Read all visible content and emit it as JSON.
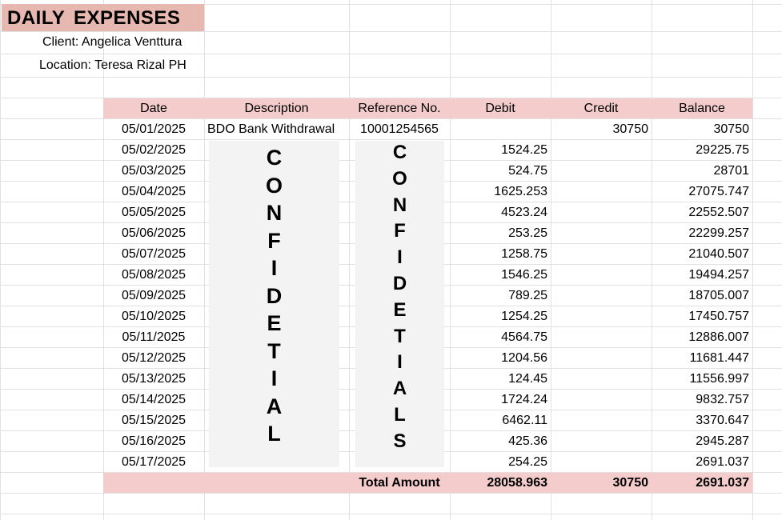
{
  "sheet": {
    "title": "DAILY  EXPENSES",
    "client_label": "Client: Angelica Venttura",
    "location_label": "Location: Teresa Rizal PH"
  },
  "table": {
    "headers": [
      "Date",
      "Description",
      "Reference No.",
      "Debit",
      "Credit",
      "Balance"
    ],
    "rows": [
      {
        "date": "05/01/2025",
        "description": "BDO Bank Withdrawal",
        "reference": "10001254565",
        "debit": "",
        "credit": "30750",
        "balance": "30750"
      },
      {
        "date": "05/02/2025",
        "description": "",
        "reference": "",
        "debit": "1524.25",
        "credit": "",
        "balance": "29225.75"
      },
      {
        "date": "05/03/2025",
        "description": "",
        "reference": "",
        "debit": "524.75",
        "credit": "",
        "balance": "28701"
      },
      {
        "date": "05/04/2025",
        "description": "",
        "reference": "",
        "debit": "1625.253",
        "credit": "",
        "balance": "27075.747"
      },
      {
        "date": "05/05/2025",
        "description": "",
        "reference": "",
        "debit": "4523.24",
        "credit": "",
        "balance": "22552.507"
      },
      {
        "date": "05/06/2025",
        "description": "",
        "reference": "",
        "debit": "253.25",
        "credit": "",
        "balance": "22299.257"
      },
      {
        "date": "05/07/2025",
        "description": "",
        "reference": "",
        "debit": "1258.75",
        "credit": "",
        "balance": "21040.507"
      },
      {
        "date": "05/08/2025",
        "description": "",
        "reference": "",
        "debit": "1546.25",
        "credit": "",
        "balance": "19494.257"
      },
      {
        "date": "05/09/2025",
        "description": "",
        "reference": "",
        "debit": "789.25",
        "credit": "",
        "balance": "18705.007"
      },
      {
        "date": "05/10/2025",
        "description": "",
        "reference": "",
        "debit": "1254.25",
        "credit": "",
        "balance": "17450.757"
      },
      {
        "date": "05/11/2025",
        "description": "",
        "reference": "",
        "debit": "4564.75",
        "credit": "",
        "balance": "12886.007"
      },
      {
        "date": "05/12/2025",
        "description": "",
        "reference": "",
        "debit": "1204.56",
        "credit": "",
        "balance": "11681.447"
      },
      {
        "date": "05/13/2025",
        "description": "",
        "reference": "",
        "debit": "124.45",
        "credit": "",
        "balance": "11556.997"
      },
      {
        "date": "05/14/2025",
        "description": "",
        "reference": "",
        "debit": "1724.24",
        "credit": "",
        "balance": "9832.757"
      },
      {
        "date": "05/15/2025",
        "description": "",
        "reference": "",
        "debit": "6462.11",
        "credit": "",
        "balance": "3370.647"
      },
      {
        "date": "05/16/2025",
        "description": "",
        "reference": "",
        "debit": "425.36",
        "credit": "",
        "balance": "2945.287"
      },
      {
        "date": "05/17/2025",
        "description": "",
        "reference": "",
        "debit": "254.25",
        "credit": "",
        "balance": "2691.037"
      }
    ],
    "total": {
      "label": "Total Amount",
      "debit": "28058.963",
      "credit": "30750",
      "balance": "2691.037"
    }
  },
  "redactions": {
    "description_mask": "CONFIDETIAL",
    "reference_mask": "CONFIDETIALS"
  },
  "colors": {
    "title_fill": "#e6b8af",
    "header_fill": "#f4cccc",
    "mask_fill": "#f3f3f3",
    "gridline": "#e1e1e1"
  }
}
